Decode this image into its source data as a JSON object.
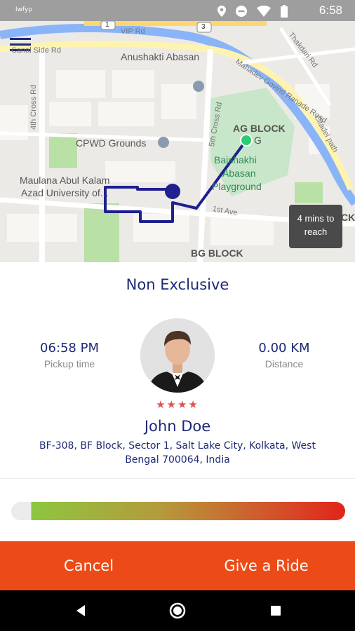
{
  "status_bar": {
    "app_tag": "lwfyp",
    "time": "6:58",
    "icons": [
      "location-icon",
      "do-not-disturb-icon",
      "wifi-icon",
      "battery-icon"
    ]
  },
  "map": {
    "menu_icon": "menu-icon",
    "labels": {
      "vip_rd": "VIP Rd",
      "road_badge_1": "1",
      "road_badge_3": "3",
      "side_rd": "Canal Side Rd",
      "thakdari": "Thakdari Rd",
      "anushakti": "Anushakti Abasan",
      "mahadev": "Mahadev Govind Ranade Road",
      "fourth_cross": "4th Cross Rd",
      "fifth_cross": "5th Cross Rd",
      "citadel": "Citadel path",
      "cpwd": "CPWD Grounds",
      "ag_block": "AG BLOCK",
      "ag_block_g": "G",
      "baishakhi_1": "Baishakhi",
      "baishakhi_2": "Abasan",
      "baishakhi_3": "Playground",
      "maulana_1": "Maulana Abul Kalam",
      "maulana_2": "Azad University of...",
      "first_ave": "1st Ave",
      "bg_block": "BG BLOCK",
      "ck": "CK"
    },
    "eta_line1": "4 mins to",
    "eta_line2": "reach"
  },
  "card": {
    "ride_type": "Non Exclusive",
    "pickup_time_value": "06:58 PM",
    "pickup_time_label": "Pickup time",
    "distance_value": "0.00 KM",
    "distance_label": "Distance",
    "rating_stars": "★★★★",
    "driver_name": "John Doe",
    "address": "BF-308, BF Block, Sector 1, Salt Lake City, Kolkata, West Bengal 700064, India"
  },
  "actions": {
    "cancel_label": "Cancel",
    "give_ride_label": "Give a Ride"
  },
  "colors": {
    "accent": "#ec4a16",
    "text_primary": "#1e2a78",
    "route": "#1f1f8f",
    "destination": "#2ecc71",
    "star": "#d9534f"
  }
}
